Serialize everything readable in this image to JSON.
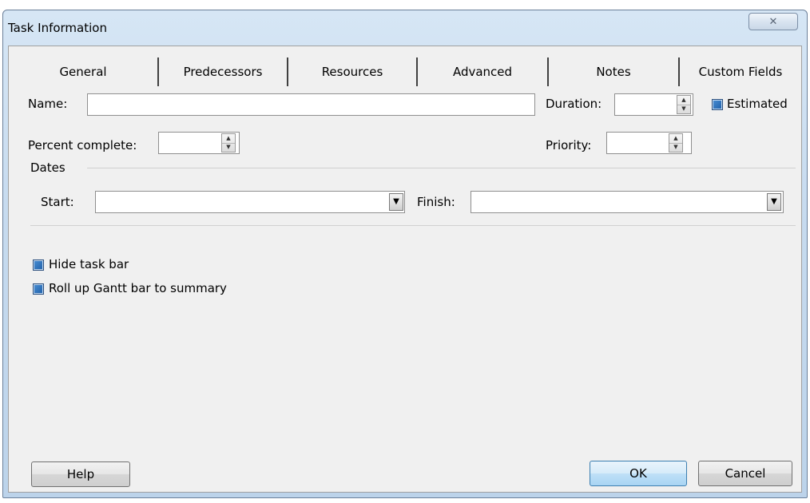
{
  "window": {
    "title": "Task Information",
    "close_glyph": "✕"
  },
  "tabs": [
    {
      "label": "General",
      "active": true
    },
    {
      "label": "Predecessors"
    },
    {
      "label": "Resources"
    },
    {
      "label": "Advanced"
    },
    {
      "label": "Notes"
    },
    {
      "label": "Custom Fields"
    }
  ],
  "fields": {
    "name": {
      "label": "Name:",
      "value": ""
    },
    "duration": {
      "label": "Duration:",
      "value": ""
    },
    "estimated": {
      "label": "Estimated",
      "checked": true
    },
    "percent_complete": {
      "label": "Percent complete:",
      "value": ""
    },
    "priority": {
      "label": "Priority:",
      "value": ""
    }
  },
  "dates": {
    "group_label": "Dates",
    "start": {
      "label": "Start:",
      "value": ""
    },
    "finish": {
      "label": "Finish:",
      "value": ""
    }
  },
  "options": {
    "hide_task_bar": {
      "label": "Hide task bar",
      "checked": true
    },
    "rollup": {
      "label": "Roll up Gantt bar to summary",
      "checked": true
    }
  },
  "buttons": {
    "help": "Help",
    "ok": "OK",
    "cancel": "Cancel"
  },
  "icons": {
    "spin_up": "▲",
    "spin_down": "▼",
    "dropdown": "▼"
  },
  "colors": {
    "checkbox": "#1f5fa8",
    "titlebar": "#c7dbef",
    "dialog_bg": "#f0f0f0"
  }
}
